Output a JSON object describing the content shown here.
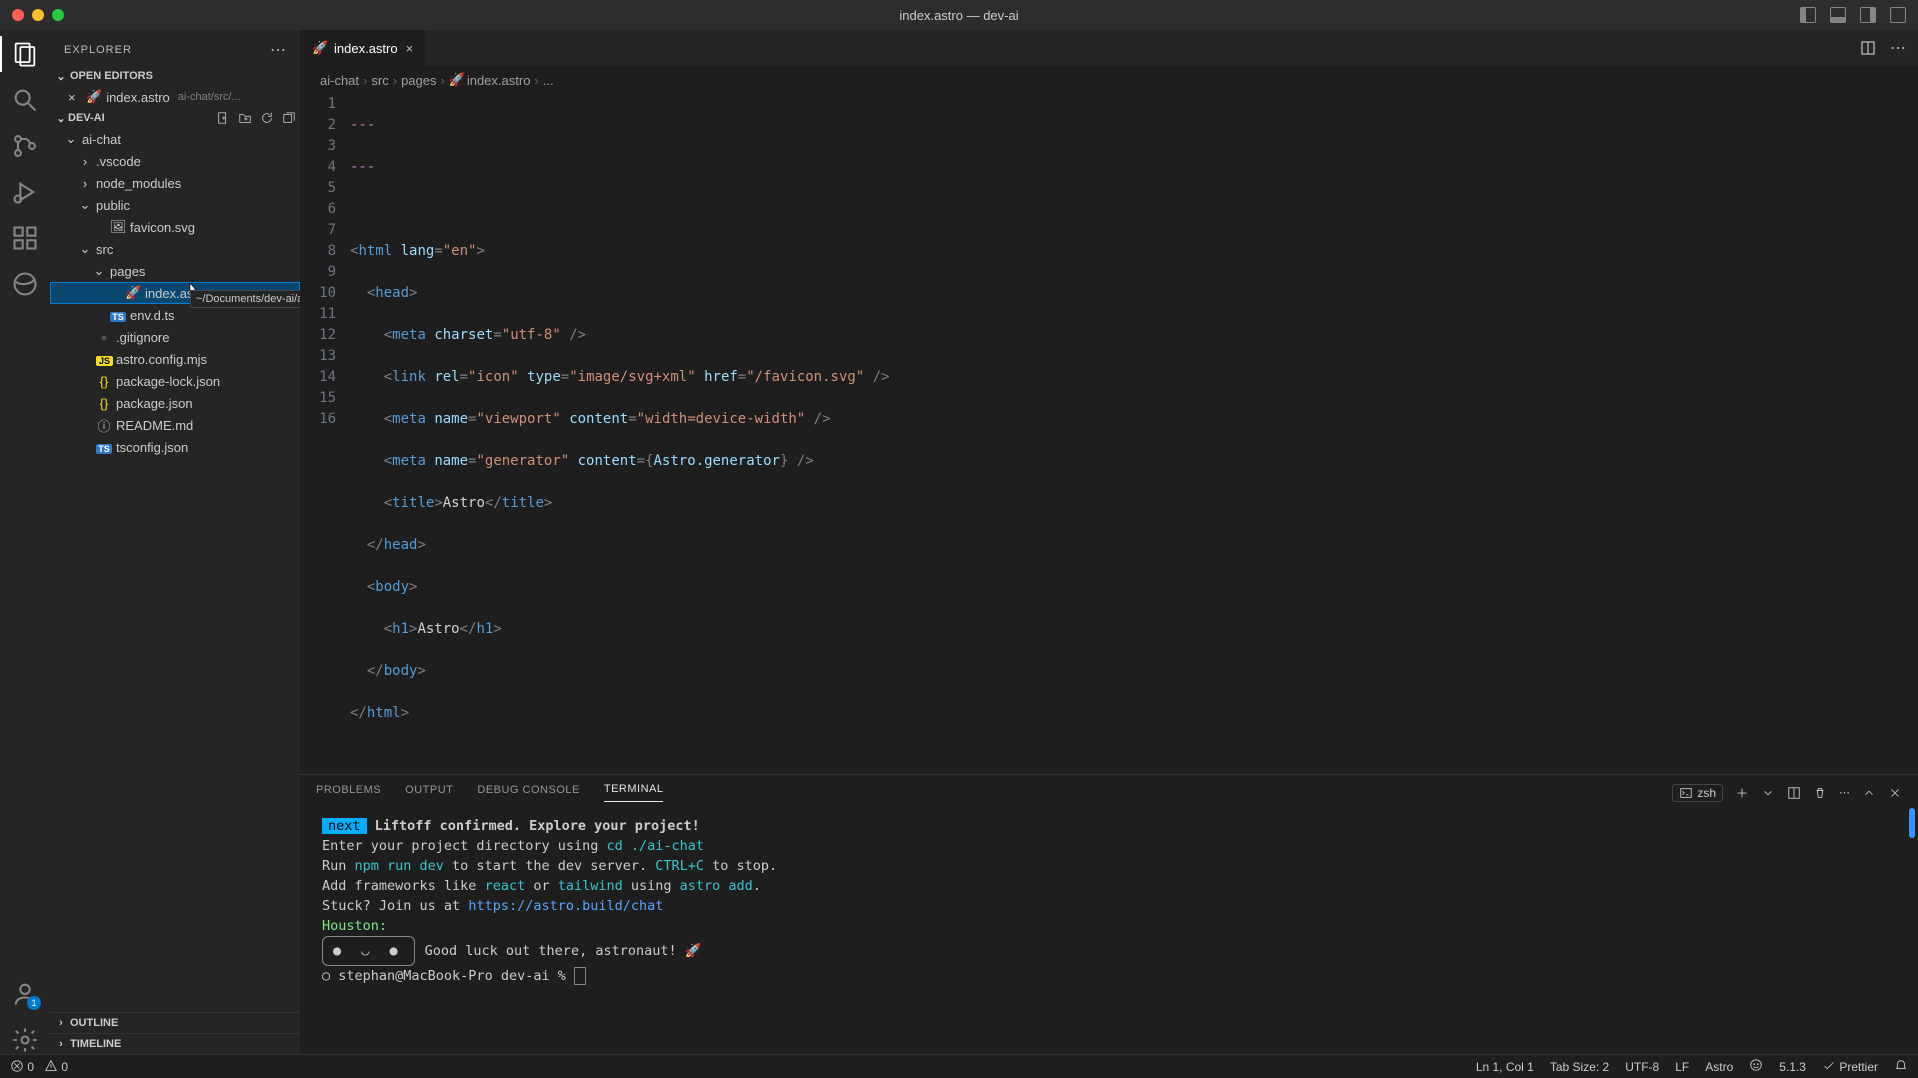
{
  "window_title": "index.astro — dev-ai",
  "sidebar": {
    "title": "EXPLORER",
    "open_editors_label": "OPEN EDITORS",
    "root_label": "DEV-AI",
    "outline_label": "OUTLINE",
    "timeline_label": "TIMELINE",
    "open_editor": {
      "name": "index.astro",
      "hint": "ai-chat/src/..."
    }
  },
  "tree": {
    "ai_chat": "ai-chat",
    "vscode": ".vscode",
    "node_modules": "node_modules",
    "public": "public",
    "favicon": "favicon.svg",
    "src": "src",
    "pages": "pages",
    "index_astro": "index.astro",
    "envdts": "env.d.ts",
    "gitignore": ".gitignore",
    "astro_config": "astro.config.mjs",
    "pkg_lock": "package-lock.json",
    "pkg": "package.json",
    "readme": "README.md",
    "tsconfig": "tsconfig.json"
  },
  "tooltip_path": "~/Documents/dev-ai/ai-chat/src/pages/index.astro",
  "tab": {
    "name": "index.astro"
  },
  "breadcrumb": {
    "p1": "ai-chat",
    "p2": "src",
    "p3": "pages",
    "p4": "index.astro",
    "p5": "..."
  },
  "code_lines": 16,
  "bottom_panel": {
    "tabs": {
      "problems": "PROBLEMS",
      "output": "OUTPUT",
      "debug": "DEBUG CONSOLE",
      "terminal": "TERMINAL"
    },
    "shell": "zsh"
  },
  "terminal": {
    "next_badge": "next",
    "headline": "Liftoff confirmed. Explore your project!",
    "l1a": "Enter your project directory using ",
    "l1b": "cd ./ai-chat",
    "l2a": "Run ",
    "l2b": "npm run dev",
    "l2c": " to start the dev server. ",
    "l2d": "CTRL+C",
    "l2e": " to stop.",
    "l3a": "Add frameworks like ",
    "l3b": "react",
    "l3c": " or ",
    "l3d": "tailwind",
    "l3e": " using ",
    "l3f": "astro add",
    "l3g": ".",
    "l4a": "Stuck? Join us at ",
    "l4b": "https://astro.build/chat",
    "l5": "Houston:",
    "l6": "Good luck out there, astronaut! 🚀",
    "prompt": "stephan@MacBook-Pro dev-ai % "
  },
  "status": {
    "errors": "0",
    "warnings": "0",
    "ln_col": "Ln 1, Col 1",
    "tab_size": "Tab Size: 2",
    "encoding": "UTF-8",
    "eol": "LF",
    "lang": "Astro",
    "version": "5.1.3",
    "prettier": "Prettier"
  }
}
